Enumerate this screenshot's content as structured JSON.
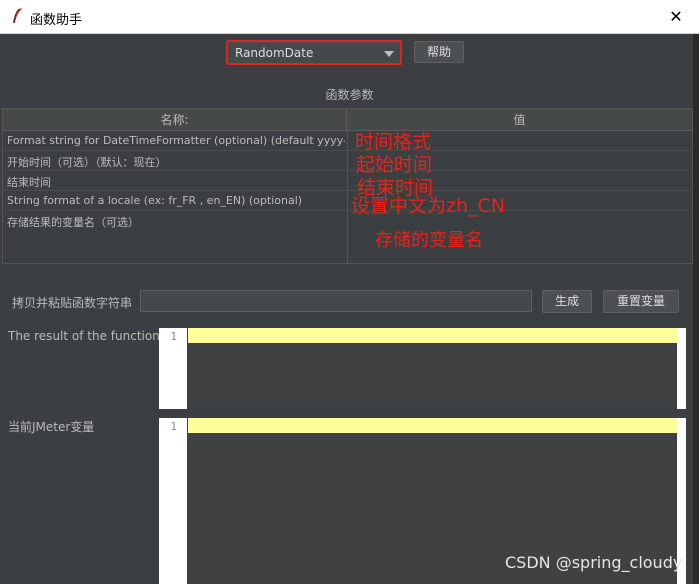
{
  "window": {
    "title": "函数助手",
    "close": "✕"
  },
  "function_select": {
    "value": "RandomDate"
  },
  "help_button": "帮助",
  "section_title": "函数参数",
  "table": {
    "headers": {
      "name": "名称:",
      "value": "值"
    },
    "rows": [
      "Format string for DateTimeFormatter (optional) (default yyyy-...",
      "开始时间（可选）（默认：现在）",
      "结束时间",
      "String format of a locale (ex: fr_FR , en_EN) (optional)",
      "存储结果的变量名（可选）"
    ]
  },
  "annotations": [
    "时间格式",
    "起始时间",
    "结束时间",
    "设置中文为zh_CN",
    "存储的变量名"
  ],
  "copy": {
    "label": "拷贝并粘贴函数字符串",
    "value": ""
  },
  "buttons": {
    "generate": "生成",
    "reset": "重置变量"
  },
  "result": {
    "label": "The result of the function is",
    "line": "1"
  },
  "vars": {
    "label": "当前JMeter变量",
    "line": "1"
  },
  "watermark": "CSDN @spring_cloudy"
}
